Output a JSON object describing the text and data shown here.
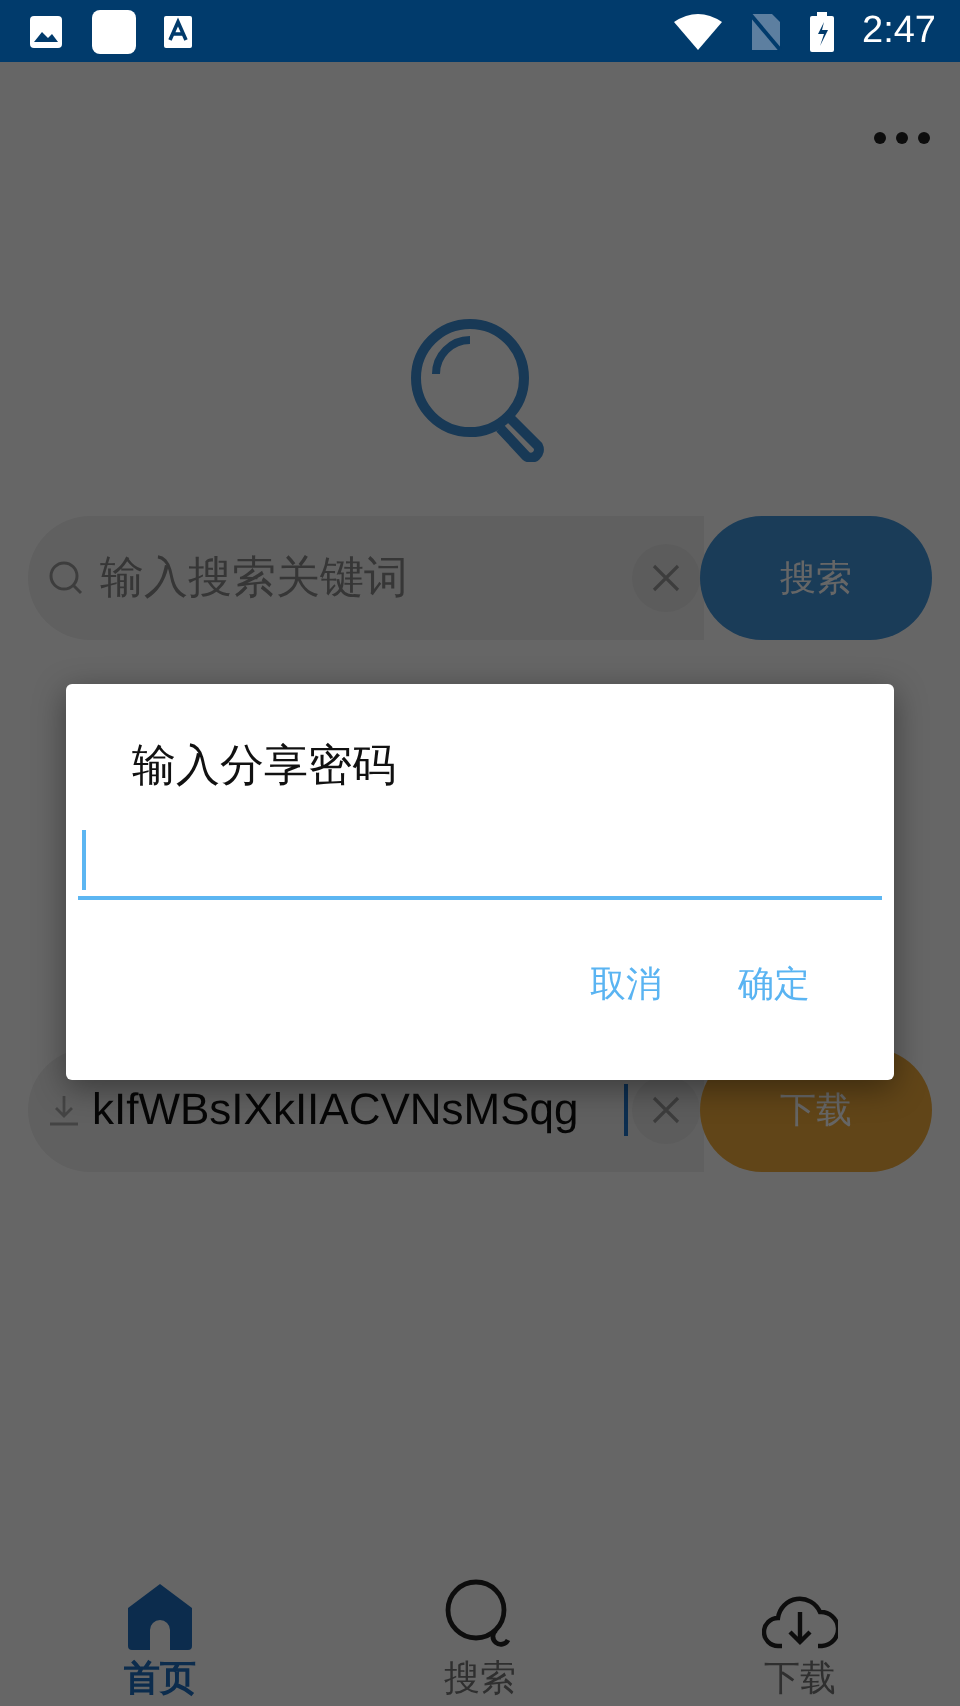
{
  "status_bar": {
    "time": "2:47"
  },
  "search": {
    "placeholder": "输入搜索关键词",
    "button": "搜索"
  },
  "download": {
    "value": "kIfWBsIXkIIACVNsMSqg",
    "button": "下载"
  },
  "dialog": {
    "title": "输入分享密码",
    "buttons": [
      "取消",
      "确定"
    ]
  },
  "tabs": [
    {
      "label": "首页",
      "selected": true
    },
    {
      "label": "搜索",
      "selected": false
    },
    {
      "label": "下载",
      "selected": false
    }
  ]
}
